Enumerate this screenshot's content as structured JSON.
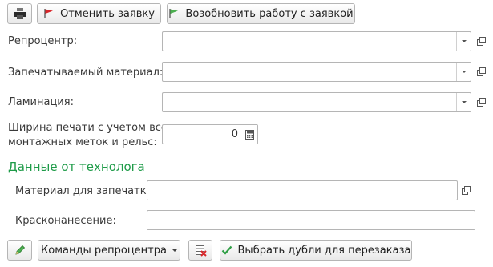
{
  "toolbar": {
    "print_icon": "printer-icon",
    "cancel_label": "Отменить заявку",
    "cancel_icon": "red-flag-icon",
    "resume_label": "Возобновить работу с заявкой",
    "resume_icon": "green-flag-icon"
  },
  "form": {
    "repro_label": "Репроцентр:",
    "repro_value": "",
    "material_label": "Запечатываемый материал:",
    "material_value": "",
    "lamination_label": "Ламинация:",
    "lamination_value": "",
    "width_label_line1": "Ширина печати с учетом всех",
    "width_label_line2": "монтажных меток и рельс:",
    "width_value": "0"
  },
  "technologist": {
    "section_title": "Данные от технолога",
    "print_material_label": "Материал для запечатки:",
    "print_material_value": "",
    "color_label": "Красконанесение:",
    "color_value": ""
  },
  "bottom": {
    "edit_icon": "pencil-icon",
    "commands_label": "Команды репроцентра",
    "delete_icon": "delete-table-icon",
    "select_label": "Выбрать дубли для перезаказа",
    "select_icon": "checkmark-icon"
  },
  "colors": {
    "accent_green": "#1e9b48",
    "flag_red": "#d9262a",
    "flag_green": "#4caf50"
  }
}
